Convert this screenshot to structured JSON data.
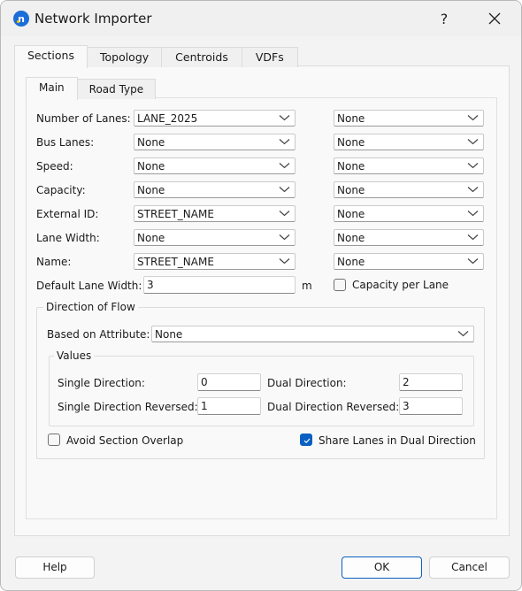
{
  "window": {
    "title": "Network Importer",
    "app_icon_letter": "n",
    "help_glyph": "?",
    "close_glyph": "✕"
  },
  "outer_tabs": [
    {
      "label": "Sections",
      "active": true
    },
    {
      "label": "Topology",
      "active": false
    },
    {
      "label": "Centroids",
      "active": false
    },
    {
      "label": "VDFs",
      "active": false
    }
  ],
  "inner_tabs": [
    {
      "label": "Main",
      "active": true
    },
    {
      "label": "Road Type",
      "active": false
    }
  ],
  "attribute_rows": [
    {
      "label": "Number of Lanes:",
      "primary": "LANE_2025",
      "secondary": "None"
    },
    {
      "label": "Bus Lanes:",
      "primary": "None",
      "secondary": "None"
    },
    {
      "label": "Speed:",
      "primary": "None",
      "secondary": "None"
    },
    {
      "label": "Capacity:",
      "primary": "None",
      "secondary": "None"
    },
    {
      "label": "External ID:",
      "primary": "STREET_NAME",
      "secondary": "None"
    },
    {
      "label": "Lane Width:",
      "primary": "None",
      "secondary": "None"
    },
    {
      "label": "Name:",
      "primary": "STREET_NAME",
      "secondary": "None"
    }
  ],
  "default_lane_width": {
    "label": "Default Lane Width:",
    "value": "3",
    "unit": "m"
  },
  "capacity_per_lane": {
    "label": "Capacity per Lane",
    "checked": false
  },
  "direction_of_flow": {
    "title": "Direction of Flow",
    "based_on_label": "Based on Attribute:",
    "based_on_value": "None",
    "values": {
      "title": "Values",
      "single_direction_label": "Single Direction:",
      "single_direction_value": "0",
      "single_direction_reversed_label": "Single Direction Reversed:",
      "single_direction_reversed_value": "1",
      "dual_direction_label": "Dual Direction:",
      "dual_direction_value": "2",
      "dual_direction_reversed_label": "Dual Direction Reversed:",
      "dual_direction_reversed_value": "3"
    },
    "avoid_section_overlap": {
      "label": "Avoid Section Overlap",
      "checked": false
    },
    "share_lanes": {
      "label": "Share Lanes in Dual Direction",
      "checked": true
    }
  },
  "buttons": {
    "help": "Help",
    "ok": "OK",
    "cancel": "Cancel"
  },
  "colors": {
    "accent": "#0a5fc2",
    "app_icon": "#1c6ed8"
  }
}
